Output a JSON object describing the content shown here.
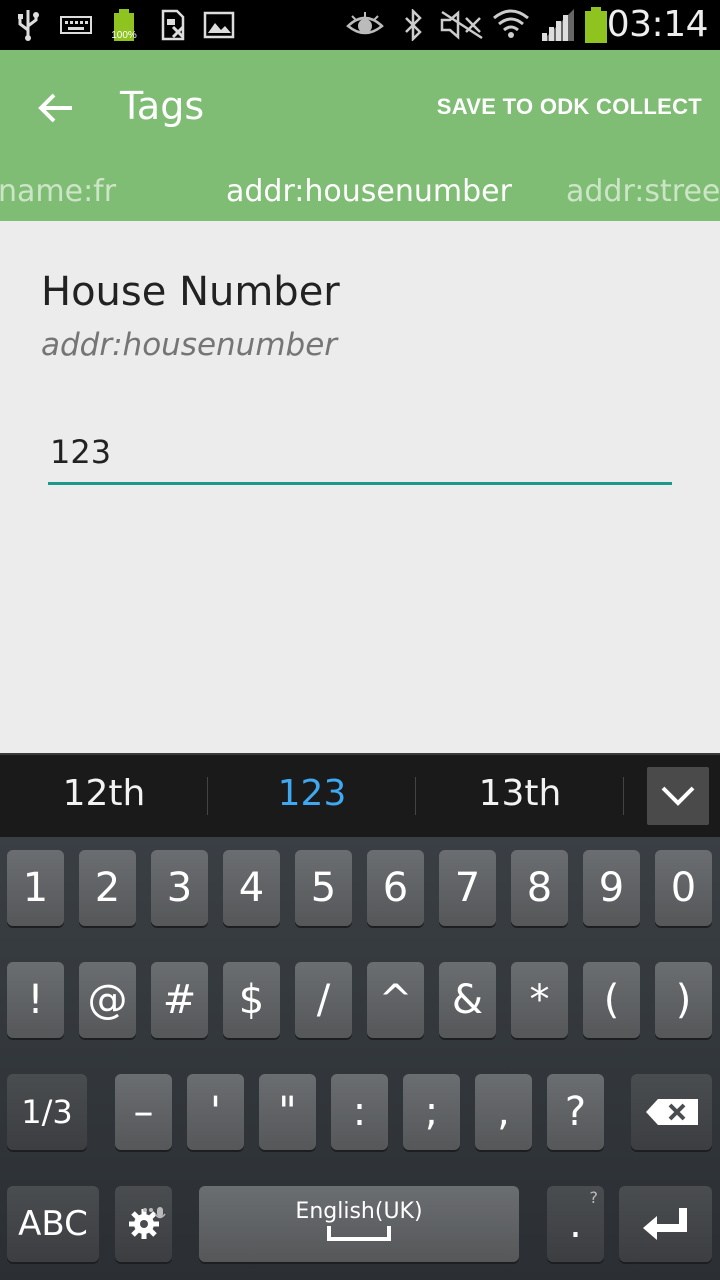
{
  "status_bar": {
    "time": "03:14",
    "battery_label": "100%",
    "icons": [
      "usb-icon",
      "keyboard-icon",
      "battery-small-icon",
      "sim-icon",
      "image-icon",
      "eye-icon",
      "bluetooth-icon",
      "mute-icon",
      "wifi-icon",
      "signal-icon",
      "battery-icon"
    ]
  },
  "app_bar": {
    "title": "Tags",
    "action_label": "SAVE TO ODK COLLECT",
    "color": "#7fbd74"
  },
  "tabs": [
    {
      "label": "name:fr",
      "active": false
    },
    {
      "label": "addr:housenumber",
      "active": true
    },
    {
      "label": "addr:street",
      "active": false
    }
  ],
  "field": {
    "label": "House Number",
    "key": "addr:housenumber",
    "value": "123",
    "underline_color": "#1b9a8b"
  },
  "keyboard": {
    "suggestions": [
      "12th",
      "123",
      "13th"
    ],
    "row1": [
      "1",
      "2",
      "3",
      "4",
      "5",
      "6",
      "7",
      "8",
      "9",
      "0"
    ],
    "row2": [
      "!",
      "@",
      "#",
      "$",
      "/",
      "^",
      "&",
      "*",
      "(",
      ")"
    ],
    "row3": [
      "1/3",
      "–",
      "'",
      "\"",
      ":",
      ";",
      ",",
      "?"
    ],
    "abc_label": "ABC",
    "space_label": "English(UK)",
    "period_key": ".",
    "period_hint": "?"
  }
}
